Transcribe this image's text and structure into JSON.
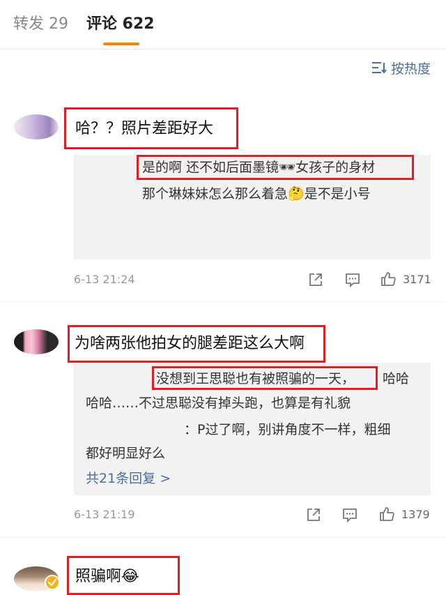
{
  "tabs": {
    "repost": "转发 29",
    "comments": "评论 622"
  },
  "sort": {
    "label": "按热度"
  },
  "comments": [
    {
      "text": "哈？？照片差距好大",
      "reply_lines": [
        "是的啊 还不如后面墨镜🕶女孩子的身材",
        "那个琳妹妹怎么那么着急🤔是不是小号"
      ],
      "time": "6-13 21:24",
      "likes": "3171"
    },
    {
      "text": "为啥两张他拍女的腿差距这么大啊",
      "reply_lines": [
        "没想到王思聪也有被照骗的一天，",
        "哈哈",
        "哈哈……不过思聪没有掉头跑，也算是有礼貌",
        "：P过了啊，别讲角度不一样，粗细",
        "都好明显好么"
      ],
      "more_replies": "共21条回复 >",
      "time": "6-13 21:19",
      "likes": "1379"
    },
    {
      "text": "照骗啊😂"
    }
  ],
  "icons": [
    "sort-icon",
    "share-icon",
    "comment-icon",
    "like-icon",
    "verified-icon"
  ],
  "colors": {
    "accent": "#ff8200",
    "link": "#4a6f9e",
    "highlight": "#e41d20",
    "verified": "#f2b31c"
  }
}
